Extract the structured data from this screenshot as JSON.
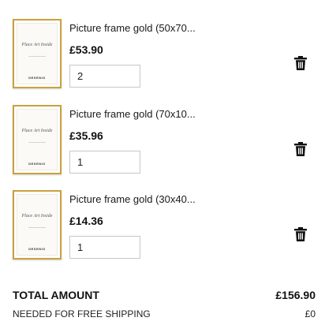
{
  "items": [
    {
      "name": "Picture frame gold (50x70...",
      "price": "£53.90",
      "quantity": "2",
      "thumb_text": "Place Art Inside",
      "thumb_brand": "DESENIO"
    },
    {
      "name": "Picture frame gold (70x10...",
      "price": "£35.96",
      "quantity": "1",
      "thumb_text": "Place Art Inside",
      "thumb_brand": "DESENIO"
    },
    {
      "name": "Picture frame gold (30x40...",
      "price": "£14.36",
      "quantity": "1",
      "thumb_text": "Place Art Inside",
      "thumb_brand": "DESENIO"
    }
  ],
  "summary": {
    "total_label": "TOTAL AMOUNT",
    "total_value": "£156.90",
    "shipping_label": "NEEDED FOR FREE SHIPPING",
    "shipping_value": "£0"
  },
  "icons": {
    "delete": "trash-icon"
  },
  "colors": {
    "frame_gold": "#c9a23e",
    "text": "#111111",
    "border": "#c8c8c8"
  }
}
